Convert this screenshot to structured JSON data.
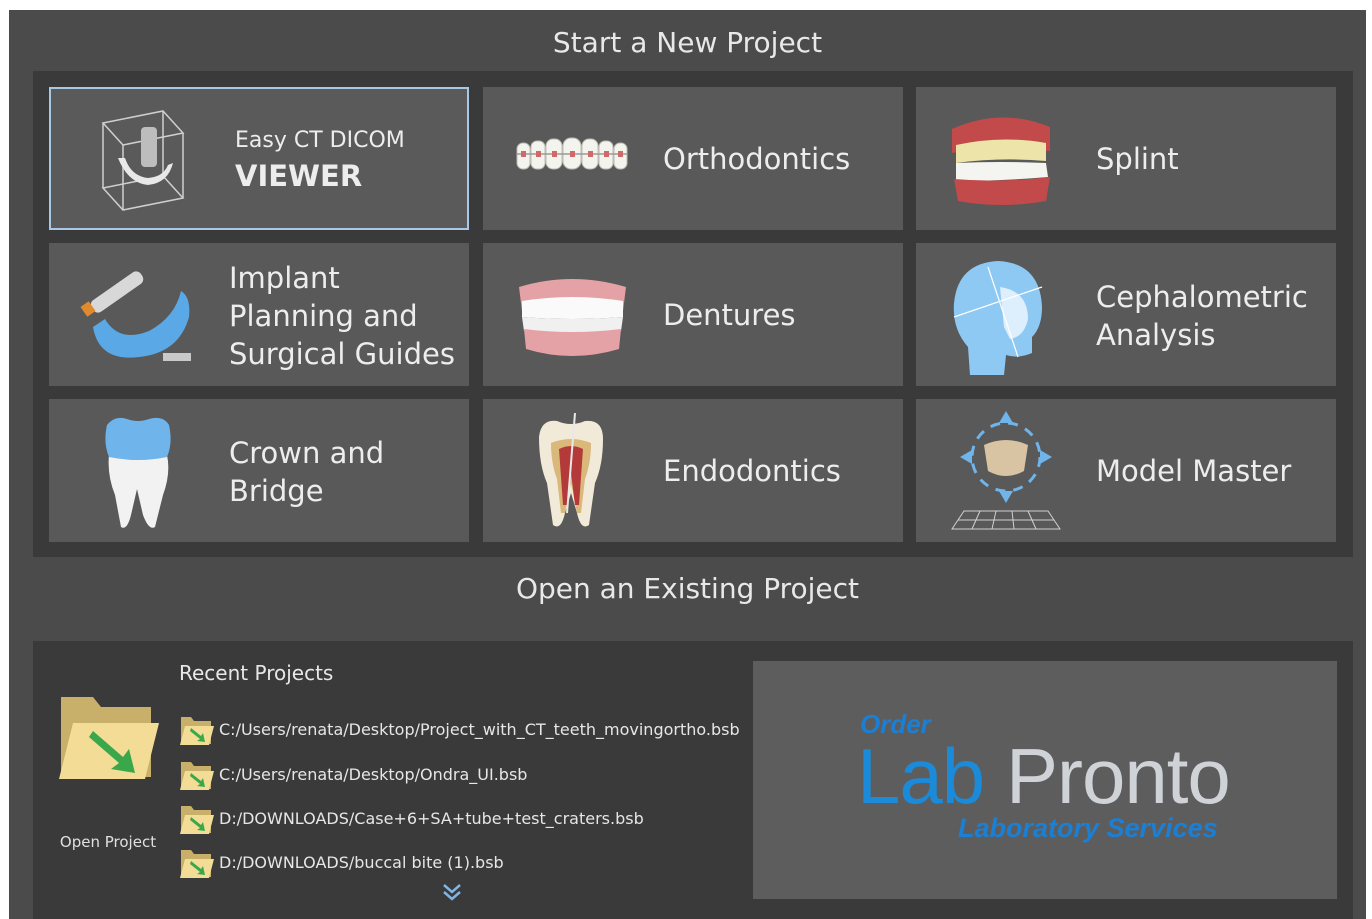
{
  "start_title": "Start a New Project",
  "open_title": "Open an Existing Project",
  "tiles": {
    "viewer": {
      "line1": "Easy CT DICOM",
      "line2": "VIEWER"
    },
    "orthodontics": {
      "label": "Orthodontics"
    },
    "splint": {
      "label": "Splint"
    },
    "implant": {
      "line1": "Implant",
      "line2": "Planning and",
      "line3": "Surgical Guides"
    },
    "dentures": {
      "label": "Dentures"
    },
    "cephalometric": {
      "line1": "Cephalometric",
      "line2": "Analysis"
    },
    "crown": {
      "line1": "Crown and",
      "line2": "Bridge"
    },
    "endodontics": {
      "label": "Endodontics"
    },
    "model_master": {
      "label": "Model Master"
    }
  },
  "recent": {
    "title": "Recent Projects",
    "open_label": "Open Project",
    "items": [
      "C:/Users/renata/Desktop/Project_with_CT_teeth_movingortho.bsb",
      "C:/Users/renata/Desktop/Ondra_UI.bsb",
      "D:/DOWNLOADS/Case+6+SA+tube+test_craters.bsb",
      "D:/DOWNLOADS/buccal bite (1).bsb"
    ]
  },
  "logo": {
    "order": "Order",
    "lab": "Lab",
    "pronto": "Pronto",
    "subtitle": "Laboratory Services"
  },
  "colors": {
    "background": "#4b4b4b",
    "tile": "#595959",
    "accent_blue": "#1b8ad9",
    "selected_border": "#a9c8e6"
  }
}
